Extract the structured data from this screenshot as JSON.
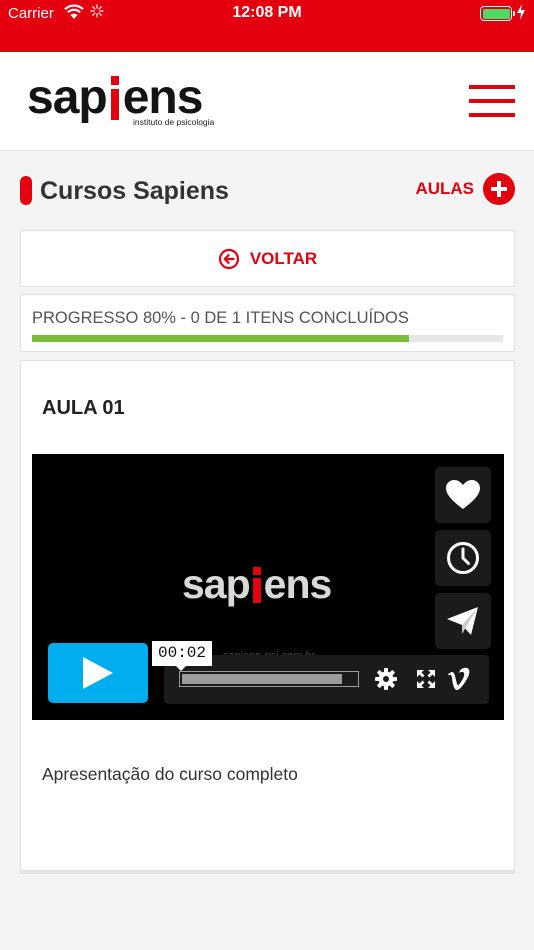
{
  "status_bar": {
    "carrier": "Carrier",
    "time": "12:08 PM",
    "battery_level": 1.0
  },
  "header": {
    "logo": {
      "text_before": "sap",
      "text_after": "ens",
      "tagline": "instituto de psicologia"
    },
    "menu_icon": "hamburger-icon"
  },
  "page": {
    "title": "Cursos Sapiens",
    "aulas_label": "AULAS",
    "aulas_icon": "plus-circle-icon"
  },
  "back": {
    "label": "VOLTAR",
    "icon": "arrow-left-circle-icon"
  },
  "progress": {
    "text": "PROGRESSO 80% - 0 DE 1 ITENS CONCLUÍDOS",
    "percent": 80
  },
  "lesson": {
    "title": "AULA 01",
    "description": "Apresentação do curso completo",
    "video": {
      "logo_before": "sap",
      "logo_after": "ens",
      "url_text": "sapiens-psi.com.br",
      "time_tooltip": "00:02",
      "played_fraction": 0.92,
      "side_buttons": [
        "heart-icon",
        "clock-icon",
        "send-icon"
      ],
      "controls": [
        "gear-icon",
        "fullscreen-icon",
        "vimeo-icon"
      ]
    }
  },
  "colors": {
    "brand_red": "#e3000f",
    "progress_green": "#7cbc3a",
    "play_blue": "#00adef",
    "battery_green": "#4cd964"
  }
}
